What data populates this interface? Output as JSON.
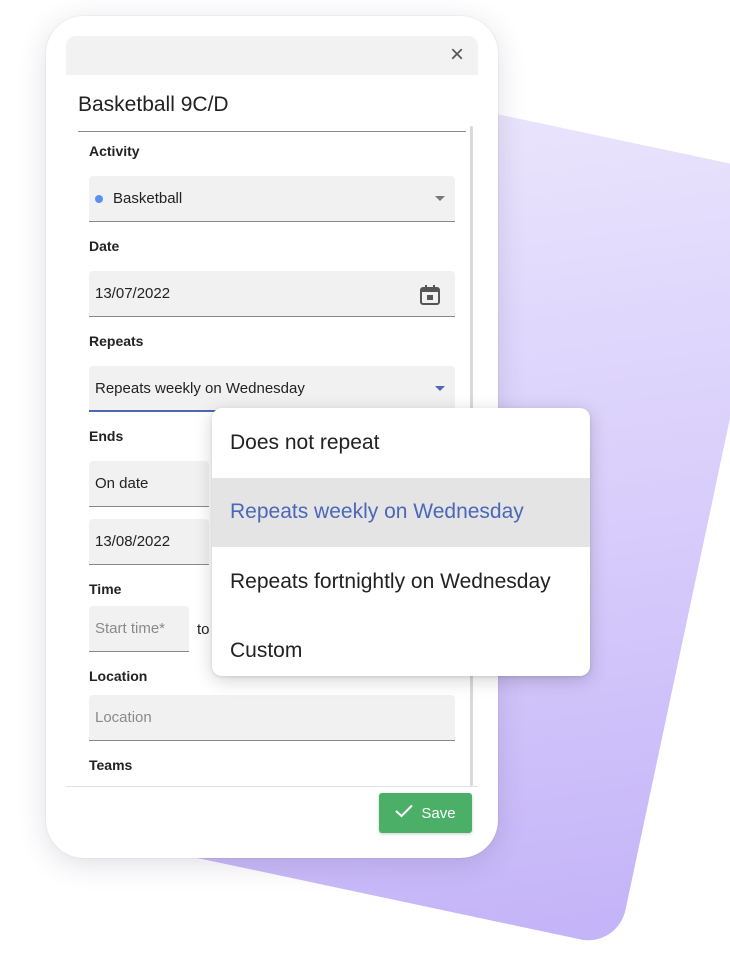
{
  "dialog": {
    "title": "Basketball 9C/D",
    "close_symbol": "×"
  },
  "form": {
    "activity": {
      "label": "Activity",
      "value": "Basketball",
      "dot_color": "#5b8ff0"
    },
    "date": {
      "label": "Date",
      "value": "13/07/2022"
    },
    "repeats": {
      "label": "Repeats",
      "value": "Repeats weekly on Wednesday"
    },
    "ends": {
      "label": "Ends",
      "value": "On date",
      "date_value": "13/08/2022"
    },
    "time": {
      "label": "Time",
      "start_placeholder": "Start time*",
      "to_text": "to"
    },
    "location": {
      "label": "Location",
      "placeholder": "Location"
    },
    "teams": {
      "label": "Teams"
    }
  },
  "footer": {
    "save_label": "Save",
    "save_color": "#4caf68"
  },
  "repeat_menu": {
    "options": [
      {
        "label": "Does not repeat"
      },
      {
        "label": "Repeats weekly on Wednesday",
        "selected": true
      },
      {
        "label": "Repeats fortnightly on Wednesday"
      },
      {
        "label": "Custom"
      }
    ],
    "accent_color": "#4a68b8"
  }
}
